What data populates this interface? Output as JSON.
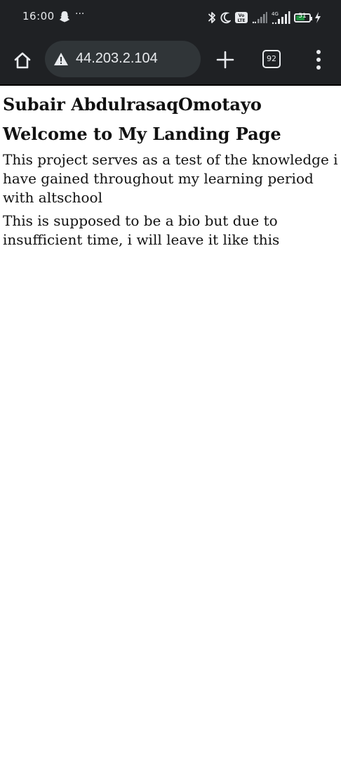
{
  "status_bar": {
    "time": "16:00",
    "more_indicator": "···",
    "icons": [
      "snapchat-ghost-icon",
      "bluetooth-icon",
      "moon-icon",
      "volte-icon",
      "signal-icon",
      "signal-4g-icon",
      "battery-icon",
      "charging-icon"
    ],
    "volte_label": "Vo LTE",
    "network_label": "4G",
    "battery_level": "51"
  },
  "browser": {
    "url": "44.203.2.104",
    "security": "not-secure-warning-icon",
    "tab_count": "92"
  },
  "page": {
    "name": "Subair AbdulrasaqOmotayo",
    "heading": "Welcome to My Landing Page",
    "paragraph_1": "This project serves as a test of the knowledge i have gained throughout my learning period with altschool",
    "paragraph_2": "This is supposed to be a bio but due to insufficient time, i will leave it like this"
  }
}
